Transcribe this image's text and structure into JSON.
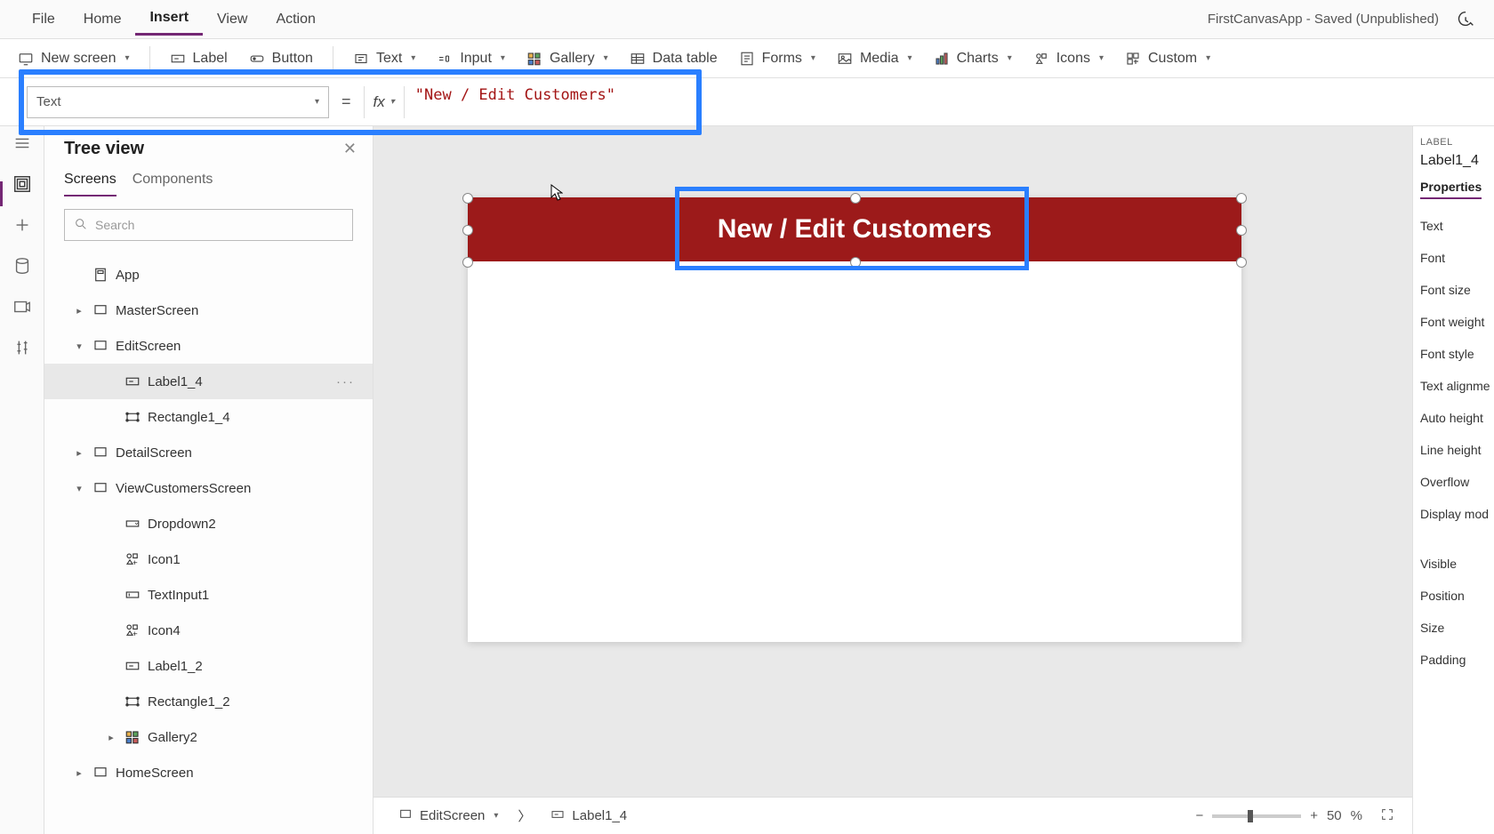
{
  "menu": {
    "items": [
      "File",
      "Home",
      "Insert",
      "View",
      "Action"
    ],
    "active": "Insert",
    "app_status": "FirstCanvasApp - Saved (Unpublished)"
  },
  "ribbon": {
    "new_screen": "New screen",
    "label": "Label",
    "button": "Button",
    "text": "Text",
    "input": "Input",
    "gallery": "Gallery",
    "data_table": "Data table",
    "forms": "Forms",
    "media": "Media",
    "charts": "Charts",
    "icons": "Icons",
    "custom": "Custom"
  },
  "formula": {
    "property": "Text",
    "fx": "fx",
    "value": "\"New / Edit Customers\""
  },
  "tree": {
    "title": "Tree view",
    "tabs": {
      "screens": "Screens",
      "components": "Components"
    },
    "search_placeholder": "Search",
    "items": [
      {
        "label": "App",
        "type": "app",
        "indent": 1,
        "arrow": ""
      },
      {
        "label": "MasterScreen",
        "type": "screen",
        "indent": 1,
        "arrow": "right"
      },
      {
        "label": "EditScreen",
        "type": "screen",
        "indent": 1,
        "arrow": "down"
      },
      {
        "label": "Label1_4",
        "type": "label",
        "indent": 2,
        "arrow": "",
        "selected": true
      },
      {
        "label": "Rectangle1_4",
        "type": "rect",
        "indent": 2,
        "arrow": ""
      },
      {
        "label": "DetailScreen",
        "type": "screen",
        "indent": 1,
        "arrow": "right"
      },
      {
        "label": "ViewCustomersScreen",
        "type": "screen",
        "indent": 1,
        "arrow": "down"
      },
      {
        "label": "Dropdown2",
        "type": "dropdown",
        "indent": 2,
        "arrow": ""
      },
      {
        "label": "Icon1",
        "type": "icon",
        "indent": 2,
        "arrow": ""
      },
      {
        "label": "TextInput1",
        "type": "textinput",
        "indent": 2,
        "arrow": ""
      },
      {
        "label": "Icon4",
        "type": "icon",
        "indent": 2,
        "arrow": ""
      },
      {
        "label": "Label1_2",
        "type": "label",
        "indent": 2,
        "arrow": ""
      },
      {
        "label": "Rectangle1_2",
        "type": "rect",
        "indent": 2,
        "arrow": ""
      },
      {
        "label": "Gallery2",
        "type": "gallery",
        "indent": 2,
        "arrow": "right"
      },
      {
        "label": "HomeScreen",
        "type": "screen",
        "indent": 1,
        "arrow": "right"
      }
    ]
  },
  "canvas": {
    "header_text": "New / Edit Customers",
    "header_bg": "#9c1a1a"
  },
  "breadcrumb": {
    "screen": "EditScreen",
    "element": "Label1_4"
  },
  "zoom": {
    "value": "50",
    "unit": "%"
  },
  "properties": {
    "type_label": "LABEL",
    "name": "Label1_4",
    "tab": "Properties",
    "rows": [
      "Text",
      "Font",
      "Font size",
      "Font weight",
      "Font style",
      "Text alignme",
      "Auto height",
      "Line height",
      "Overflow",
      "Display mod",
      "Visible",
      "Position",
      "Size",
      "Padding"
    ]
  }
}
